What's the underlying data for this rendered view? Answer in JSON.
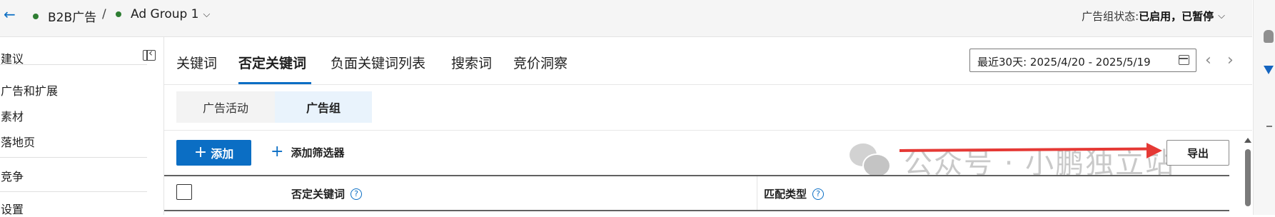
{
  "breadcrumb": {
    "campaign": "B2B广告",
    "separator": "/",
    "ad_group": "Ad Group 1"
  },
  "status": {
    "label": "广告组状态:",
    "value": "已启用，已暂停"
  },
  "sidebar": {
    "items": [
      {
        "label": "建议"
      },
      {
        "label": "广告和扩展"
      },
      {
        "label": "素材"
      },
      {
        "label": "落地页"
      },
      {
        "label": "竞争"
      },
      {
        "label": "设置"
      }
    ]
  },
  "tabs": [
    {
      "label": "关键词",
      "active": false
    },
    {
      "label": "否定关键词",
      "active": true
    },
    {
      "label": "负面关键词列表",
      "active": false
    },
    {
      "label": "搜索词",
      "active": false
    },
    {
      "label": "竞价洞察",
      "active": false
    }
  ],
  "date_range": {
    "text": "最近30天: 2025/4/20 - 2025/5/19"
  },
  "segments": [
    {
      "label": "广告活动",
      "active": false
    },
    {
      "label": "广告组",
      "active": true
    }
  ],
  "toolbar": {
    "add_label": "添加",
    "filter_label": "添加筛选器",
    "export_label": "导出"
  },
  "watermark": {
    "text": "公众号 · 小鹏独立站"
  },
  "table": {
    "columns": [
      {
        "label": "否定关键词"
      },
      {
        "label": "匹配类型"
      }
    ]
  },
  "icons": {
    "help": "?",
    "back": "←",
    "chevron": "⌵"
  },
  "colors": {
    "accent": "#0b6ec4",
    "status_dot": "#2e7d32",
    "annotation_arrow": "#e53935"
  }
}
